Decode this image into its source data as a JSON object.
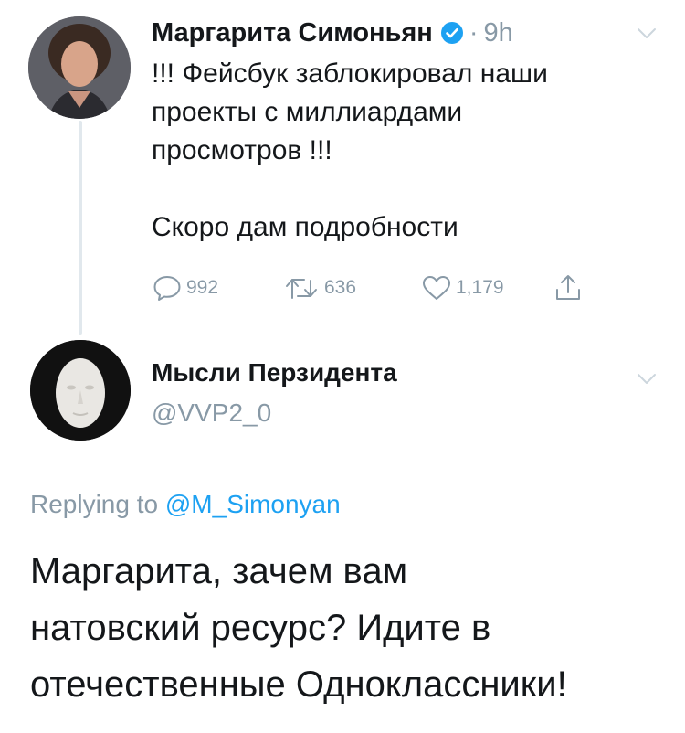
{
  "colors": {
    "muted": "#8899a6",
    "link": "#1da1f2",
    "verified": "#1da1f2",
    "text": "#14171a",
    "thread_line": "#e1e8ed"
  },
  "tweet1": {
    "author_name": "Маргарита Симоньян",
    "verified_icon": "verified-badge-icon",
    "separator": "·",
    "time": "9h",
    "text_lines": [
      "!!! Фейсбук заблокировал наши",
      "проекты с миллиардами",
      "просмотров !!!",
      "Скоро дам подробности"
    ],
    "actions": {
      "reply_count": "992",
      "retweet_count": "636",
      "like_count": "1,179"
    }
  },
  "tweet2": {
    "author_name": "Мысли Перзидента",
    "handle": "@VVP2_0",
    "replying_prefix": "Replying to",
    "replying_mention": "@M_Simonyan",
    "text_lines": [
      "Маргарита, зачем вам",
      "натовский ресурс? Идите в",
      "отечественные Одноклассники!"
    ]
  }
}
